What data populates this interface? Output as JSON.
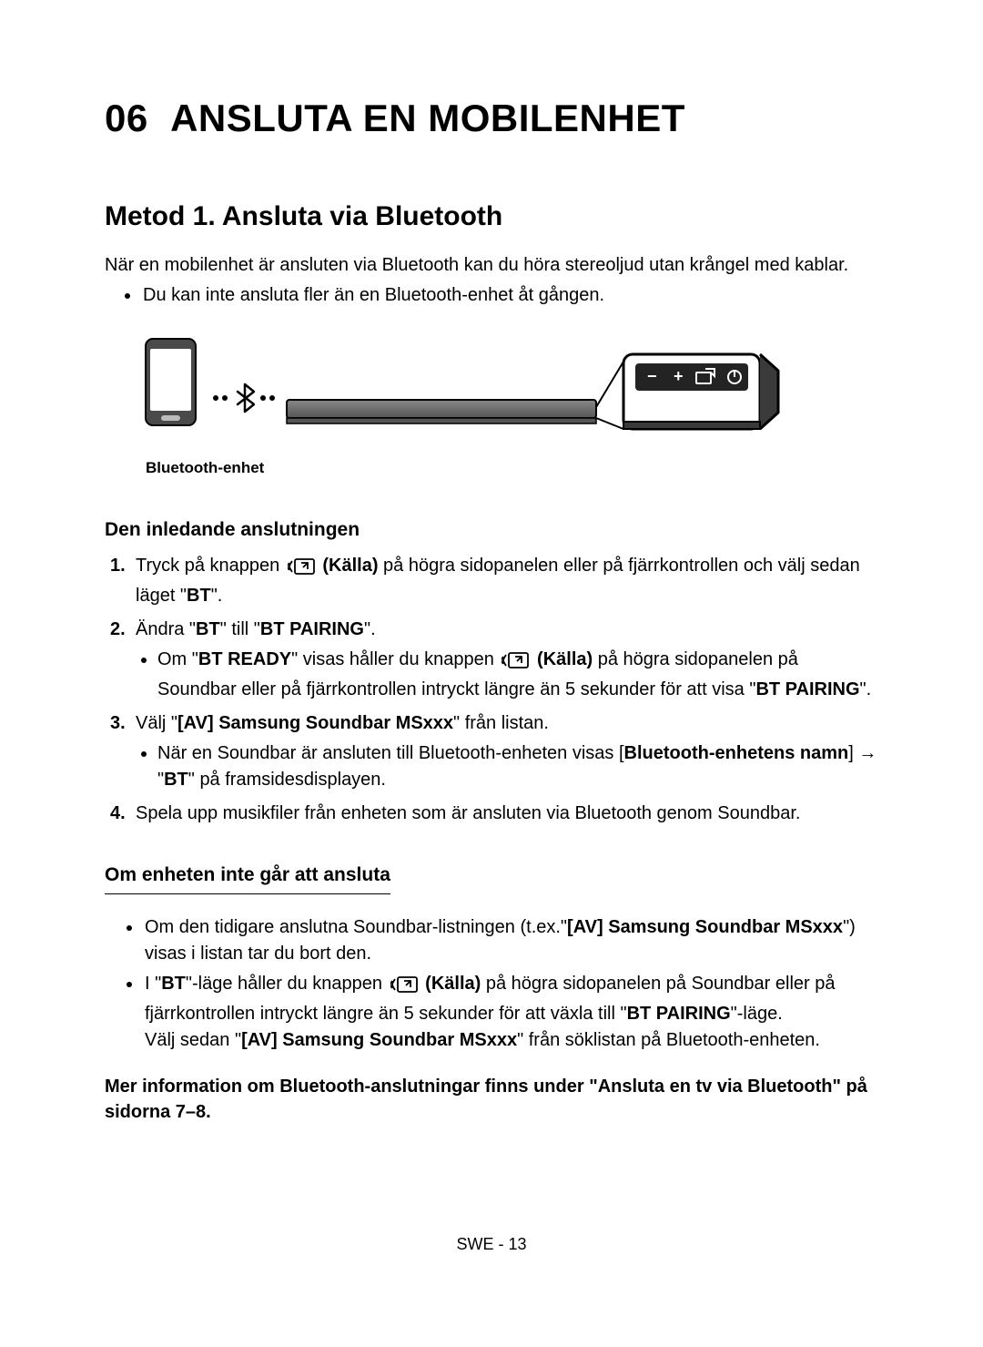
{
  "chapter": {
    "number": "06",
    "title": "ANSLUTA EN MOBILENHET"
  },
  "section1": {
    "heading": "Metod 1. Ansluta via Bluetooth",
    "intro": "När en mobilenhet är ansluten via Bluetooth kan du höra stereoljud utan krångel med kablar.",
    "bullet1": "Du kan inte ansluta fler än en Bluetooth-enhet åt gången.",
    "diagram_caption": "Bluetooth-enhet"
  },
  "initial": {
    "heading": "Den inledande anslutningen",
    "step1_a": "Tryck på knappen ",
    "step1_kalla": "(Källa)",
    "step1_b": " på högra sidopanelen eller på fjärrkontrollen och välj sedan läget \"",
    "step1_bt": "BT",
    "step1_c": "\".",
    "step2_a": "Ändra \"",
    "step2_bt": "BT",
    "step2_b": "\" till \"",
    "step2_btpairing": "BT PAIRING",
    "step2_c": "\".",
    "step2_sub_a": "Om \"",
    "step2_sub_btready": "BT READY",
    "step2_sub_b": "\" visas håller du knappen ",
    "step2_sub_kalla": "(Källa)",
    "step2_sub_c": " på högra sidopanelen på Soundbar eller på fjärrkontrollen intryckt längre än 5 sekunder för att visa \"",
    "step2_sub_btpairing": "BT PAIRING",
    "step2_sub_d": "\".",
    "step3_a": "Välj \"",
    "step3_av": "[AV] Samsung Soundbar MSxxx",
    "step3_b": "\"  från listan.",
    "step3_sub_a": "När en Soundbar är ansluten till Bluetooth-enheten visas [",
    "step3_sub_name": "Bluetooth-enhetens namn",
    "step3_sub_b": "] → \"",
    "step3_sub_bt": "BT",
    "step3_sub_c": "\" på framsidesdisplayen.",
    "step4": "Spela upp musikfiler från enheten som är ansluten via Bluetooth genom Soundbar."
  },
  "trouble": {
    "heading": "Om enheten inte går att ansluta",
    "b1_a": "Om den tidigare anslutna Soundbar-listningen (t.ex.\"",
    "b1_av": "[AV] Samsung Soundbar MSxxx",
    "b1_b": "\") visas i listan tar du bort den.",
    "b2_a": "I \"",
    "b2_bt": "BT",
    "b2_b": "\"-läge håller du knappen ",
    "b2_kalla": "(Källa)",
    "b2_c": " på högra sidopanelen på Soundbar eller på fjärrkontrollen intryckt längre än 5 sekunder för att växla till \"",
    "b2_btpairing": "BT PAIRING",
    "b2_d": "\"-läge.",
    "b2_e_a": "Välj sedan \"",
    "b2_e_av": "[AV] Samsung Soundbar MSxxx",
    "b2_e_b": "\" från söklistan på Bluetooth-enheten."
  },
  "note": "Mer information om Bluetooth-anslutningar finns under \"Ansluta en tv via Bluetooth\" på sidorna 7–8.",
  "footer": "SWE - 13"
}
